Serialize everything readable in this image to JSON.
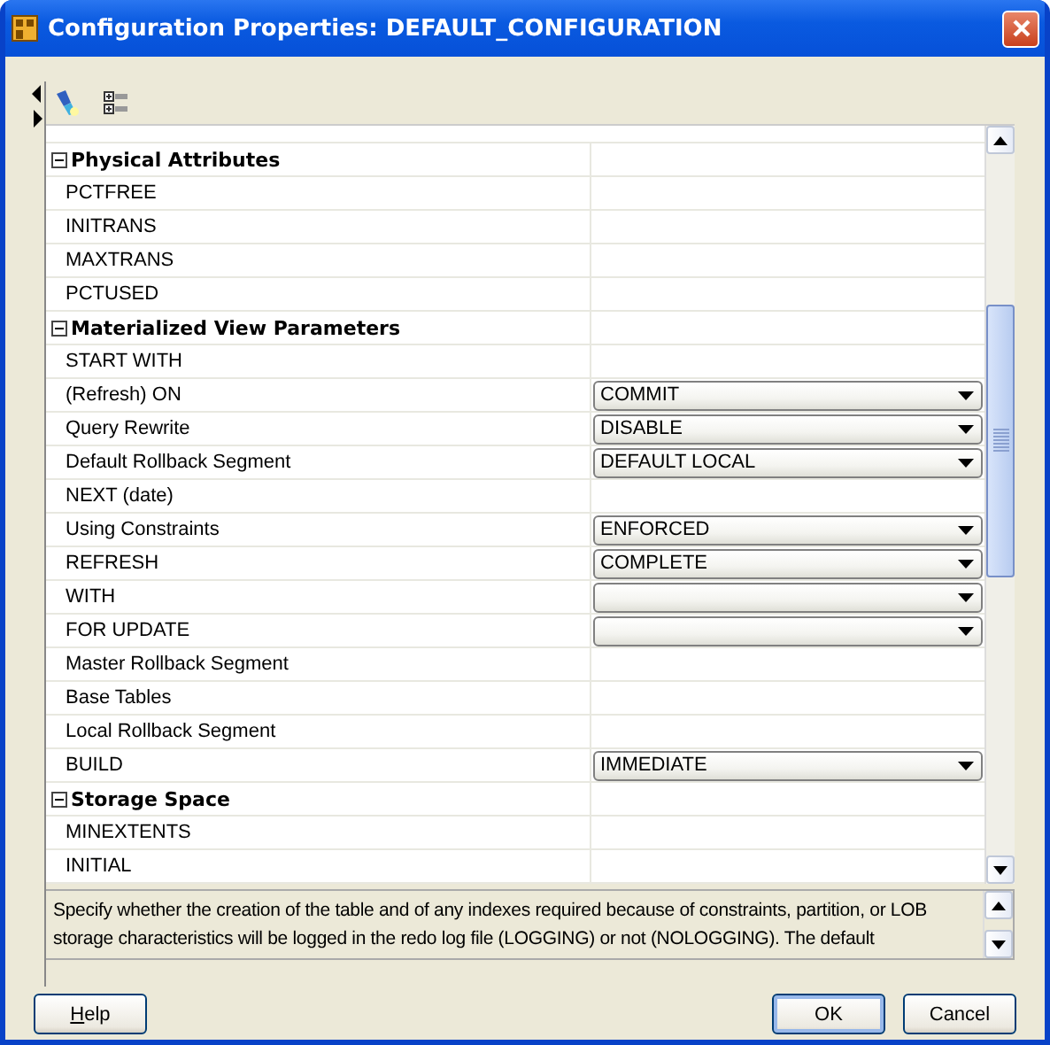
{
  "window": {
    "title": "Configuration Properties: DEFAULT_CONFIGURATION"
  },
  "properties": [
    {
      "kind": "group",
      "label": "Physical Attributes",
      "expanded": true
    },
    {
      "kind": "text",
      "label": "PCTFREE"
    },
    {
      "kind": "text",
      "label": "INITRANS"
    },
    {
      "kind": "text",
      "label": "MAXTRANS"
    },
    {
      "kind": "text",
      "label": "PCTUSED"
    },
    {
      "kind": "group",
      "label": "Materialized View Parameters",
      "expanded": true
    },
    {
      "kind": "text",
      "label": "START WITH"
    },
    {
      "kind": "select",
      "label": "(Refresh) ON",
      "value": "COMMIT"
    },
    {
      "kind": "select",
      "label": "Query Rewrite",
      "value": "DISABLE"
    },
    {
      "kind": "select",
      "label": "Default Rollback Segment",
      "value": "DEFAULT LOCAL"
    },
    {
      "kind": "text",
      "label": "NEXT (date)"
    },
    {
      "kind": "select",
      "label": "Using Constraints",
      "value": "ENFORCED"
    },
    {
      "kind": "select",
      "label": "REFRESH",
      "value": "COMPLETE"
    },
    {
      "kind": "select",
      "label": "WITH"
    },
    {
      "kind": "select",
      "label": "FOR UPDATE"
    },
    {
      "kind": "text",
      "label": "Master Rollback Segment"
    },
    {
      "kind": "text",
      "label": "Base Tables"
    },
    {
      "kind": "text",
      "label": "Local Rollback Segment"
    },
    {
      "kind": "select",
      "label": "BUILD",
      "value": "IMMEDIATE"
    },
    {
      "kind": "group",
      "label": "Storage Space",
      "expanded": true
    },
    {
      "kind": "text",
      "label": "MINEXTENTS"
    },
    {
      "kind": "text",
      "label": "INITIAL"
    }
  ],
  "description": "Specify whether the creation of the table and of any indexes required because of constraints, partition, or LOB storage characteristics will be logged in the redo log file (LOGGING) or not (NOLOGGING). The default",
  "buttons": [
    {
      "label": "Help",
      "kind": "help"
    },
    {
      "label": "OK",
      "kind": "default"
    },
    {
      "label": "Cancel",
      "kind": "normal"
    }
  ]
}
